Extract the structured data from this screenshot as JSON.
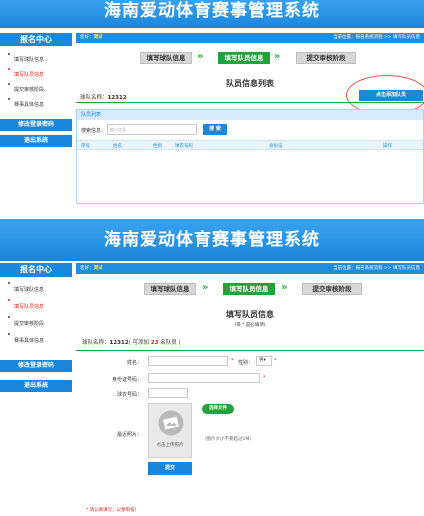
{
  "site_title": "海南爱动体育赛事管理系统",
  "sidebar": {
    "header": "报名中心",
    "items": [
      {
        "label": "填写球队信息"
      },
      {
        "label": "填写队员信息"
      },
      {
        "label": "提交审核阶段"
      },
      {
        "label": "赛事具体信息"
      }
    ],
    "change_password": "修改登录密码",
    "logout": "退出系统"
  },
  "topbar": {
    "welcome": "您好：",
    "username": "测试",
    "breadcrumb": "当前位置：报名系统流程 >> 填写队员信息"
  },
  "steps": [
    {
      "label": "填写球队信息"
    },
    {
      "label": "填写队员信息"
    },
    {
      "label": "提交审核阶段"
    }
  ],
  "list_page": {
    "title": "队员信息列表",
    "team_label": "球队名称：",
    "team_name": "12312",
    "add_button": "点击添加队员",
    "section_title": "队员列表",
    "search_label": "搜索信息：",
    "search_placeholder": "输入信息",
    "search_button": "搜 索",
    "columns": [
      "序号",
      "姓名",
      "性别",
      "球衣号码",
      "身份证",
      "操作"
    ]
  },
  "form_page": {
    "title": "填写队员信息",
    "subtitle": "(带 * 是必填项)",
    "team_label": "球队名称：",
    "team_name": "12312",
    "quota_prefix": "( 可添加 ",
    "quota_number": "23",
    "quota_suffix": " 名队员 )",
    "name_label": "姓名：",
    "gender_label": "性别：",
    "gender_value": "男",
    "id_label": "身份证号码：",
    "jersey_label": "球衣号码：",
    "photo_label": "最近照片：",
    "upload_hint": "点击上传照片",
    "choose_file": "选择文件",
    "size_note": "（图片大小不要超过1M）",
    "submit": "提交",
    "footer_note": "* 请认真填写，以便审核！"
  },
  "colors": {
    "accent_blue": "#1a86dc",
    "active_red": "#d9251c",
    "step_green": "#22a23a",
    "highlight_circle": "#e0594c"
  }
}
